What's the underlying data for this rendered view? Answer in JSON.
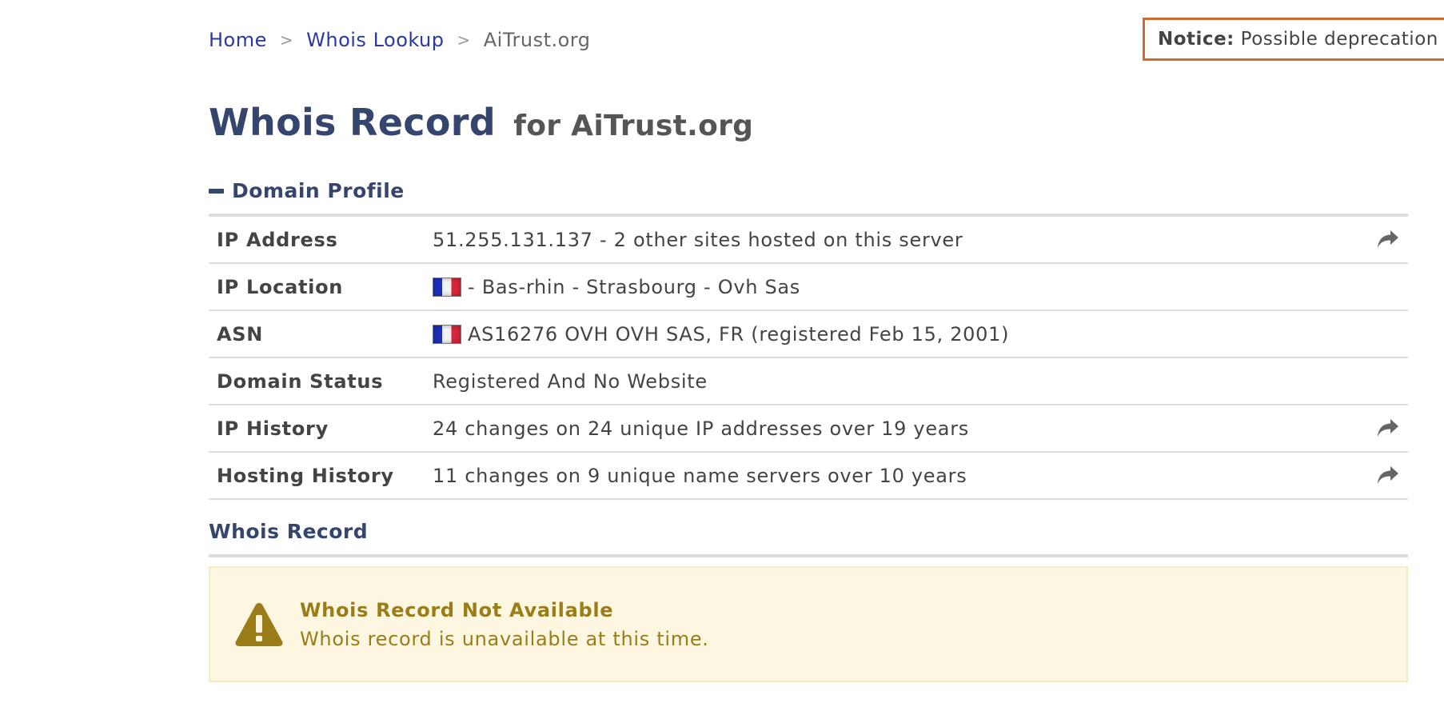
{
  "breadcrumb": {
    "home": "Home",
    "lookup": "Whois Lookup",
    "current": "AiTrust.org",
    "separator": ">"
  },
  "notice": {
    "label": "Notice:",
    "text": "Possible deprecation"
  },
  "title": {
    "main": "Whois Record",
    "sub": "for AiTrust.org"
  },
  "domain_profile": {
    "heading": "Domain Profile",
    "rows": [
      {
        "label": "IP Address",
        "value": "51.255.131.137 - 2 other sites hosted on this server",
        "has_share": true
      },
      {
        "label": "IP Location",
        "value": "- Bas-rhin - Strasbourg - Ovh Sas",
        "flag": "france-flag"
      },
      {
        "label": "ASN",
        "value": "AS16276 OVH OVH SAS, FR (registered Feb 15, 2001)",
        "flag": "france-flag"
      },
      {
        "label": "Domain Status",
        "value": "Registered And No Website"
      },
      {
        "label": "IP History",
        "value": "24 changes on 24 unique IP addresses over 19 years",
        "has_share": true
      },
      {
        "label": "Hosting History",
        "value": "11 changes on 9 unique name servers over 10 years",
        "has_share": true
      }
    ]
  },
  "whois_record": {
    "heading": "Whois Record",
    "alert_title": "Whois Record Not Available",
    "alert_text": "Whois record is unavailable at this time."
  },
  "colors": {
    "link": "#2a3a9e",
    "heading": "#36456e",
    "notice_border": "#d2692e",
    "alert_bg": "#fdf7e1",
    "alert_text": "#9a7c18"
  },
  "icons": {
    "share": "share-arrow-icon",
    "collapse": "minus-icon",
    "warning": "warning-triangle-icon"
  }
}
